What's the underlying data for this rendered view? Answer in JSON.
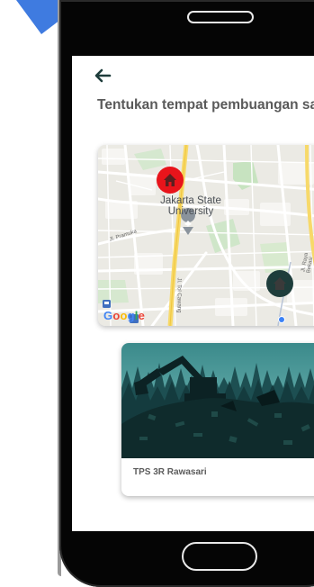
{
  "header": {
    "title": "Tentukan tempat pembuangan sampah tujuan Anda!"
  },
  "map": {
    "place_label": "Jakarta State University",
    "road_labels": [
      "Jl. Pramuka",
      "Jl. Tol Cawang",
      "Jl. Raya Bekasi"
    ],
    "provider": "Google",
    "provider_colors": [
      "#4285F4",
      "#EA4335",
      "#FBBC05",
      "#4285F4",
      "#34A853",
      "#EA4335"
    ],
    "selected_marker_color": "#e8141b",
    "other_marker_color": "#1e3d3b",
    "my_location_color": "#3b82f6"
  },
  "locations": [
    {
      "name": "TPS 3R Rawasari"
    }
  ],
  "colors": {
    "accent": "#1e3d3b",
    "title": "#5a5a5a",
    "corner": "#3f7be0"
  }
}
